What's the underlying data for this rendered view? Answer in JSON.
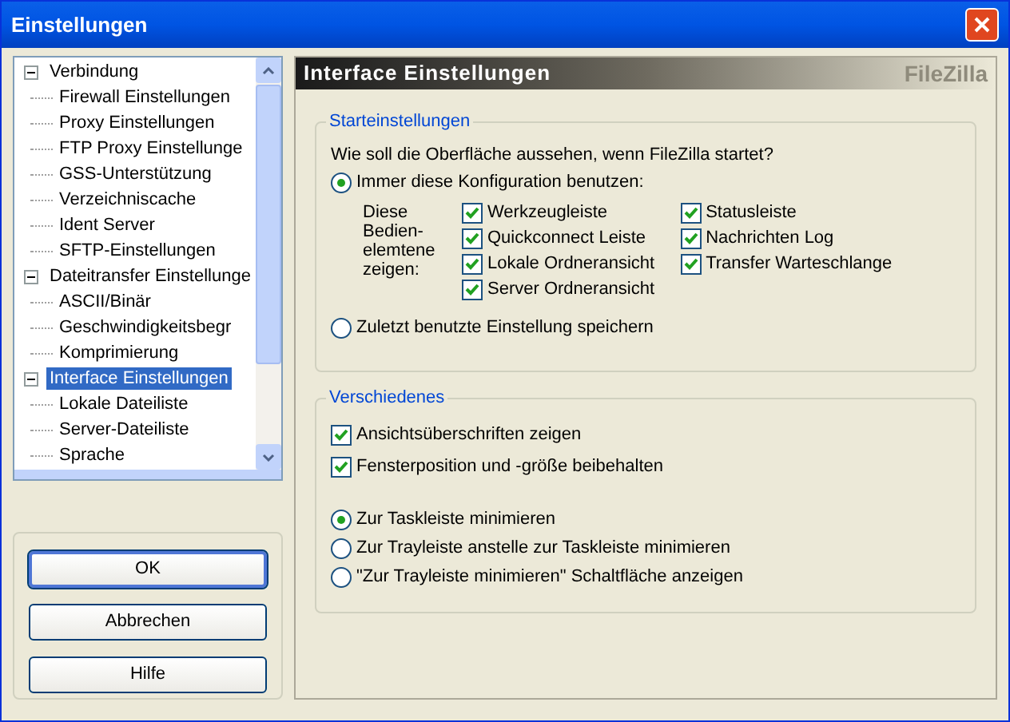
{
  "window": {
    "title": "Einstellungen"
  },
  "tree": [
    {
      "label": "Verbindung",
      "expanded": true,
      "selected": false,
      "children": [
        {
          "label": "Firewall Einstellungen",
          "selected": false
        },
        {
          "label": "Proxy Einstellungen",
          "selected": false
        },
        {
          "label": "FTP Proxy Einstellunge",
          "selected": false
        },
        {
          "label": "GSS-Unterstützung",
          "selected": false
        },
        {
          "label": "Verzeichniscache",
          "selected": false
        },
        {
          "label": "Ident Server",
          "selected": false
        },
        {
          "label": "SFTP-Einstellungen",
          "selected": false
        }
      ]
    },
    {
      "label": "Dateitransfer Einstellunge",
      "expanded": true,
      "selected": false,
      "children": [
        {
          "label": "ASCII/Binär",
          "selected": false
        },
        {
          "label": "Geschwindigkeitsbegr",
          "selected": false
        },
        {
          "label": "Komprimierung",
          "selected": false
        }
      ]
    },
    {
      "label": "Interface Einstellungen",
      "expanded": true,
      "selected": true,
      "children": [
        {
          "label": "Lokale Dateiliste",
          "selected": false
        },
        {
          "label": "Server-Dateiliste",
          "selected": false
        },
        {
          "label": "Sprache",
          "selected": false
        }
      ]
    }
  ],
  "buttons": [
    {
      "label": "OK",
      "default": true
    },
    {
      "label": "Abbrechen",
      "default": false
    },
    {
      "label": "Hilfe",
      "default": false
    }
  ],
  "panel": {
    "title": "Interface Einstellungen",
    "brand": "FileZilla",
    "startup": {
      "title": "Starteinstellungen",
      "question": "Wie soll die Oberfläche aussehen, wenn FileZilla startet?",
      "radios": [
        {
          "label": "Immer diese Konfiguration benutzen:",
          "selected": true
        },
        {
          "label": "Zuletzt benutzte Einstellung speichern",
          "selected": false
        }
      ],
      "controls_label": "Diese Bedien-elemtene zeigen:",
      "columns": [
        [
          {
            "label": "Werkzeugleiste",
            "checked": true
          },
          {
            "label": "Quickconnect Leiste",
            "checked": true
          },
          {
            "label": "Lokale Ordneransicht",
            "checked": true
          },
          {
            "label": "Server Ordneransicht",
            "checked": true
          }
        ],
        [
          {
            "label": "Statusleiste",
            "checked": true
          },
          {
            "label": "Nachrichten Log",
            "checked": true
          },
          {
            "label": "Transfer Warteschlange",
            "checked": true
          }
        ]
      ]
    },
    "misc": {
      "title": "Verschiedenes",
      "checkboxes": [
        {
          "label": "Ansichtsüberschriften zeigen",
          "checked": true
        },
        {
          "label": "Fensterposition und -größe beibehalten",
          "checked": true
        }
      ],
      "radios": [
        {
          "label": "Zur Taskleiste minimieren",
          "selected": true
        },
        {
          "label": "Zur Trayleiste anstelle zur Taskleiste minimieren",
          "selected": false
        },
        {
          "label": "\"Zur Trayleiste minimieren\" Schaltfläche anzeigen",
          "selected": false
        }
      ]
    }
  }
}
